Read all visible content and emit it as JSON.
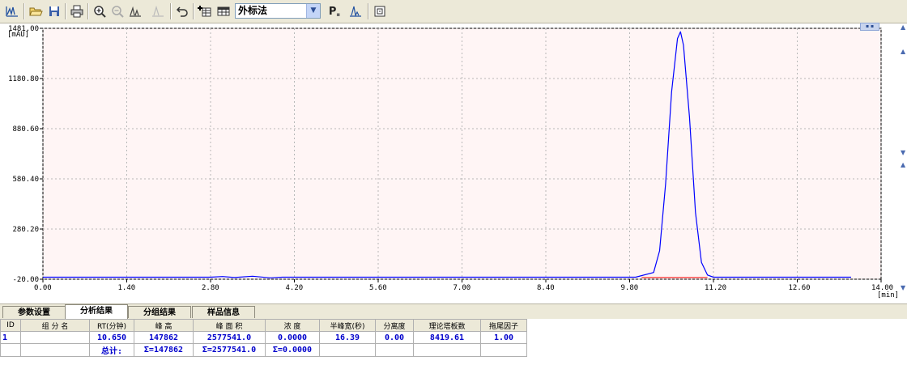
{
  "toolbar": {
    "method_select_value": "外标法",
    "p_button_label": "P",
    "icons": [
      "chromatogram-icon",
      "open-folder-icon",
      "save-icon",
      "print-icon",
      "zoom-in-icon",
      "zoom-out-icon",
      "peak-icon",
      "peak-disabled-icon",
      "undo-icon",
      "integrate-icon",
      "table-icon",
      "peak-label-icon",
      "peak-icon",
      "refresh-icon"
    ]
  },
  "chart": {
    "y_unit": "[mAU]",
    "x_unit": "[min]",
    "colors": {
      "background": "#fff5f5",
      "signal": "#0000ff",
      "baseline": "#ff0000",
      "grid": "#b8b8b8"
    }
  },
  "chart_data": {
    "type": "line",
    "x_ticks": [
      "0.00",
      "1.40",
      "2.80",
      "4.20",
      "5.60",
      "7.00",
      "8.40",
      "9.80",
      "11.20",
      "12.60",
      "14.00"
    ],
    "y_ticks": [
      "-20.00",
      "280.20",
      "580.40",
      "880.60",
      "1180.80",
      "1481.00"
    ],
    "xlim": [
      0,
      14
    ],
    "ylim": [
      -20,
      1481
    ],
    "ylabel": "[mAU]",
    "xlabel": "[min]",
    "grid": true,
    "series": [
      {
        "x": [
          0.0,
          2.8,
          3.0,
          3.2,
          3.5,
          3.8,
          4.0,
          4.2,
          9.9,
          10.2,
          10.3,
          10.4,
          10.5,
          10.6,
          10.65,
          10.7,
          10.8,
          10.9,
          11.0,
          11.1,
          11.2,
          13.5
        ],
        "y": [
          -8,
          -8,
          -4,
          -10,
          -2,
          -12,
          -8,
          -8,
          -8,
          20,
          150,
          550,
          1100,
          1420,
          1460,
          1380,
          950,
          380,
          80,
          5,
          -8,
          -8
        ]
      },
      {
        "x": [
          10.0,
          11.1
        ],
        "y": [
          -10,
          -10
        ]
      }
    ]
  },
  "tabs": [
    {
      "label": "参数设置",
      "active": false
    },
    {
      "label": "分析结果",
      "active": true
    },
    {
      "label": "分组结果",
      "active": false
    },
    {
      "label": "样品信息",
      "active": false
    }
  ],
  "table": {
    "headers": [
      "ID",
      "组 分 名",
      "RT(分钟)",
      "峰  高",
      "峰 面 积",
      "浓  度",
      "半峰宽(秒)",
      "分离度",
      "理论塔板数",
      "拖尾因子"
    ],
    "rows": [
      [
        "1",
        "",
        "10.650",
        "147862",
        "2577541.0",
        "0.0000",
        "16.39",
        "0.00",
        "8419.61",
        "1.00"
      ]
    ],
    "totals": [
      "",
      "",
      "总计:",
      "Σ=147862",
      "Σ=2577541.0",
      "Σ=0.0000",
      "",
      "",
      "",
      ""
    ]
  }
}
